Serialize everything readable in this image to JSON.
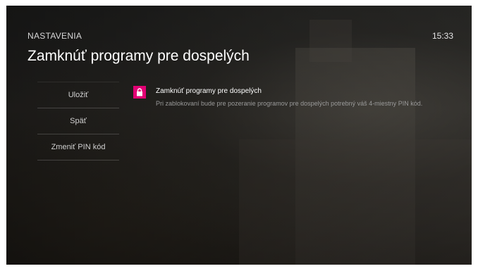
{
  "header": {
    "section": "NASTAVENIA",
    "title": "Zamknúť programy pre dospelých",
    "time": "15:33"
  },
  "menu": {
    "items": [
      {
        "label": "Uložiť"
      },
      {
        "label": "Späť"
      },
      {
        "label": "Zmeniť PIN kód"
      }
    ]
  },
  "detail": {
    "icon": "lock-icon",
    "accent_color": "#e20074",
    "title": "Zamknúť programy pre dospelých",
    "description": "Pri zablokovaní bude pre pozeranie programov pre dospelých potrebný váš 4-miestny PIN kód."
  }
}
